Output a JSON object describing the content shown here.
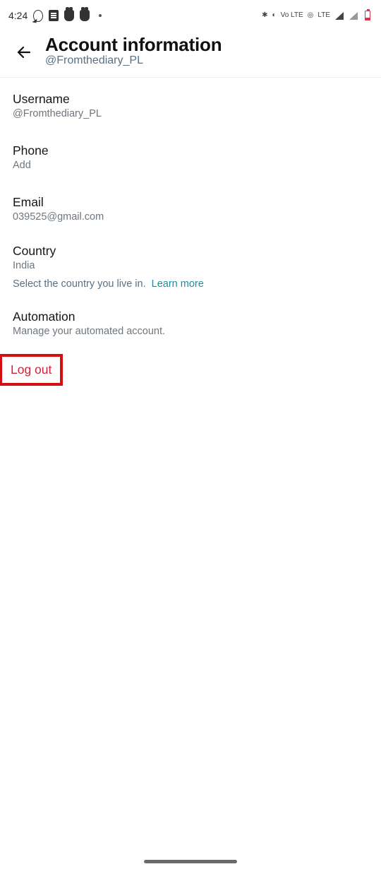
{
  "status": {
    "time": "4:24",
    "volte": "Vo\nLTE",
    "lte": "LTE"
  },
  "header": {
    "title": "Account information",
    "subtitle": "@Fromthediary_PL"
  },
  "rows": {
    "username": {
      "label": "Username",
      "value": "@Fromthediary_PL"
    },
    "phone": {
      "label": "Phone",
      "value": "Add"
    },
    "email": {
      "label": "Email",
      "value": "039525@gmail.com"
    },
    "country": {
      "label": "Country",
      "value": "India",
      "help_prefix": "Select the country you live in.",
      "learn_more": "Learn more"
    },
    "automation": {
      "label": "Automation",
      "value": "Manage your automated account."
    }
  },
  "logout": "Log out"
}
